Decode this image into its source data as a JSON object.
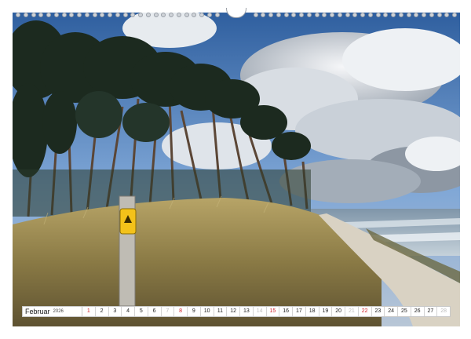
{
  "calendar": {
    "month": "Februar",
    "year": "2026",
    "days": [
      {
        "n": "1",
        "kind": "sunday"
      },
      {
        "n": "2",
        "kind": "weekday"
      },
      {
        "n": "3",
        "kind": "weekday"
      },
      {
        "n": "4",
        "kind": "weekday"
      },
      {
        "n": "5",
        "kind": "weekday"
      },
      {
        "n": "6",
        "kind": "weekday"
      },
      {
        "n": "7",
        "kind": "faded"
      },
      {
        "n": "8",
        "kind": "sunday"
      },
      {
        "n": "9",
        "kind": "weekday"
      },
      {
        "n": "10",
        "kind": "weekday"
      },
      {
        "n": "11",
        "kind": "weekday"
      },
      {
        "n": "12",
        "kind": "weekday"
      },
      {
        "n": "13",
        "kind": "weekday"
      },
      {
        "n": "14",
        "kind": "faded"
      },
      {
        "n": "15",
        "kind": "sunday"
      },
      {
        "n": "16",
        "kind": "weekday"
      },
      {
        "n": "17",
        "kind": "weekday"
      },
      {
        "n": "18",
        "kind": "weekday"
      },
      {
        "n": "19",
        "kind": "weekday"
      },
      {
        "n": "20",
        "kind": "weekday"
      },
      {
        "n": "21",
        "kind": "faded"
      },
      {
        "n": "22",
        "kind": "sunday"
      },
      {
        "n": "23",
        "kind": "weekday"
      },
      {
        "n": "24",
        "kind": "weekday"
      },
      {
        "n": "25",
        "kind": "weekday"
      },
      {
        "n": "26",
        "kind": "weekday"
      },
      {
        "n": "27",
        "kind": "weekday"
      },
      {
        "n": "28",
        "kind": "faded"
      }
    ]
  },
  "photo": {
    "subject": "coastal-pine-forest-dune",
    "colors": {
      "sky_top": "#3f6fae",
      "sky_mid": "#7ea6d6",
      "cloud": "#eef1f4",
      "cloud_shadow": "#8d97a3",
      "sea": "#9fb0bf",
      "trees": "#1c2a1f",
      "grass": "#9c8a52",
      "sand": "#d9d2c3",
      "sign": "#f3c21a"
    }
  }
}
